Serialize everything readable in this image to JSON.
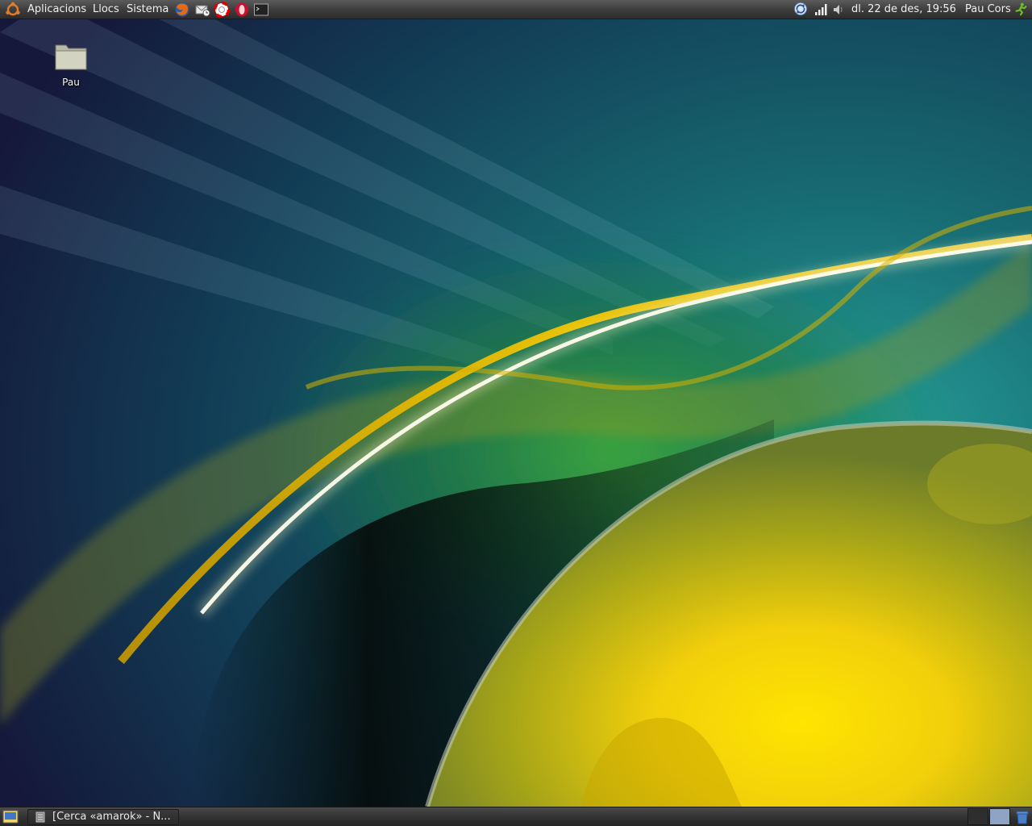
{
  "top_panel": {
    "menus": [
      "Aplicacions",
      "Llocs",
      "Sistema"
    ],
    "launchers": [
      "firefox-icon",
      "mail-icon",
      "help-icon",
      "opera-icon",
      "terminal-icon"
    ],
    "tray": {
      "clock": "dl. 22 de des, 19:56",
      "user": "Pau Cors"
    }
  },
  "desktop": {
    "icons": [
      {
        "label": "Pau",
        "icon": "folder-icon"
      }
    ]
  },
  "bottom_panel": {
    "tasks": [
      {
        "label": "[Cerca «amarok» - N..."
      }
    ]
  },
  "colors": {
    "panel": "#3e3e3e",
    "accent_yellow": "#f5c400",
    "teal": "#1a6d7a",
    "green": "#2f8a3a"
  }
}
